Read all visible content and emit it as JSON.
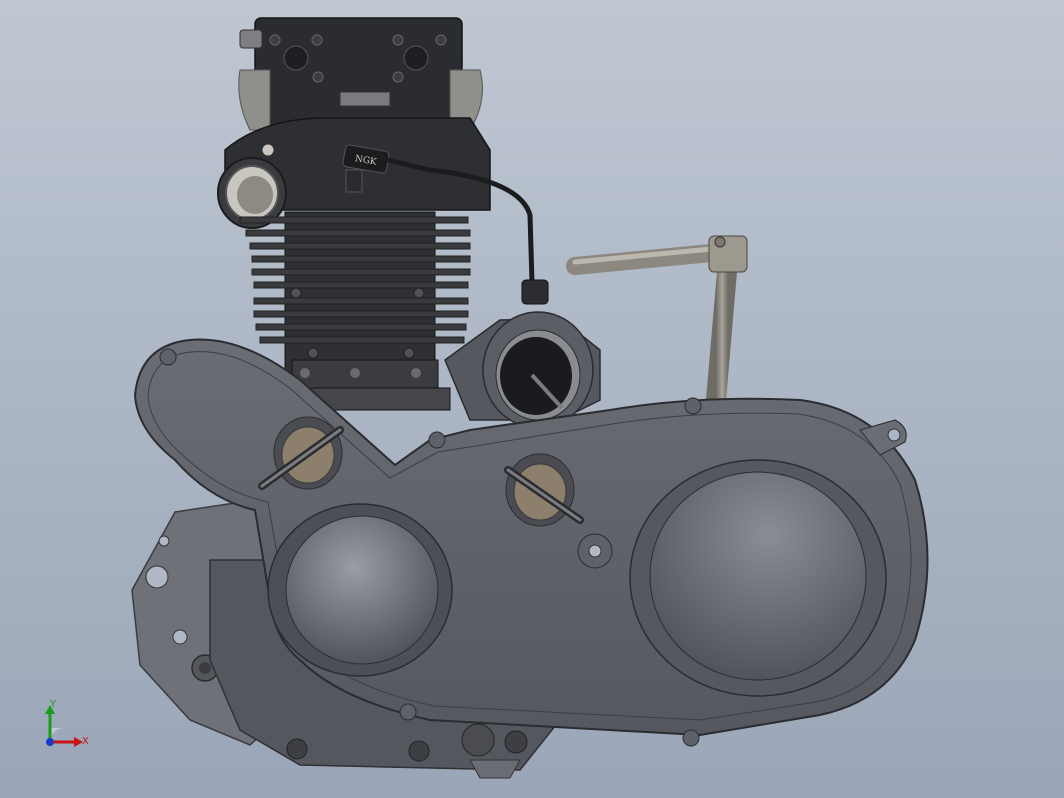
{
  "viewport": {
    "background_top": "#bfc7d2",
    "background_bottom": "#9aa6b8"
  },
  "model": {
    "spark_plug_cap_text": "NGK",
    "body_color": "#5c5f66",
    "dark_color": "#2b2c30",
    "light_color": "#8b8e95"
  },
  "triad": {
    "y_label": "Y",
    "x_label": "X",
    "y_color": "#1a9a1a",
    "x_color": "#c81414",
    "z_color": "#1838c8"
  }
}
